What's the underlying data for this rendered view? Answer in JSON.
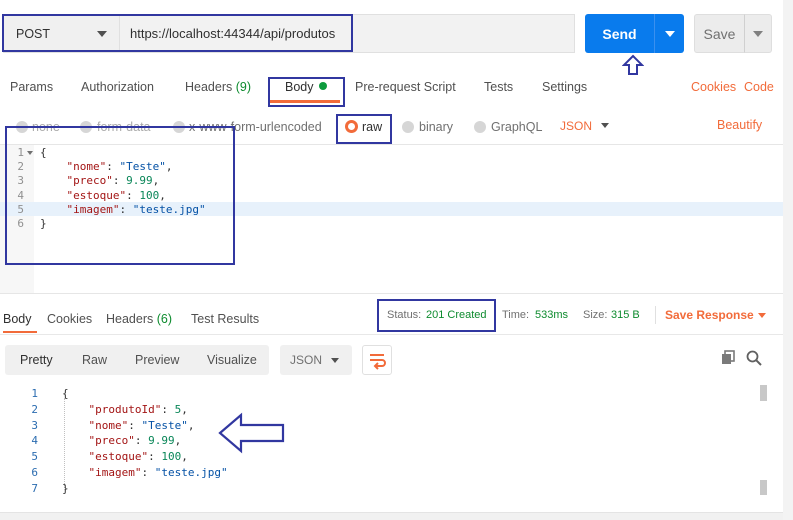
{
  "request": {
    "method": "POST",
    "url": "https://localhost:44344/api/produtos",
    "send_label": "Send",
    "save_label": "Save"
  },
  "request_tabs": {
    "params": "Params",
    "authorization": "Authorization",
    "headers": "Headers",
    "headers_count": "(9)",
    "body": "Body",
    "prerequest": "Pre-request Script",
    "tests": "Tests",
    "settings": "Settings",
    "cookies": "Cookies",
    "code": "Code"
  },
  "body_types": {
    "none": "none",
    "form_data": "form-data",
    "urlencoded": "x-www-form-urlencoded",
    "raw": "raw",
    "binary": "binary",
    "graphql": "GraphQL",
    "format": "JSON",
    "beautify": "Beautify"
  },
  "request_editor": {
    "line_numbers": [
      "1",
      "2",
      "3",
      "4",
      "5",
      "6"
    ],
    "lines": [
      {
        "pre": "{",
        "key": "",
        "mid": "",
        "val": "",
        "post": ""
      },
      {
        "pre": "    ",
        "key": "\"nome\"",
        "mid": ": ",
        "val": "\"Teste\"",
        "post": ","
      },
      {
        "pre": "    ",
        "key": "\"preco\"",
        "mid": ": ",
        "val": "9.99",
        "post": ","
      },
      {
        "pre": "    ",
        "key": "\"estoque\"",
        "mid": ": ",
        "val": "100",
        "post": ","
      },
      {
        "pre": "    ",
        "key": "\"imagem\"",
        "mid": ": ",
        "val": "\"teste.jpg\"",
        "post": ""
      },
      {
        "pre": "}",
        "key": "",
        "mid": "",
        "val": "",
        "post": ""
      }
    ]
  },
  "response_tabs": {
    "body": "Body",
    "cookies": "Cookies",
    "headers": "Headers",
    "headers_count": "(6)",
    "test_results": "Test Results"
  },
  "response_meta": {
    "status_label": "Status:",
    "status_value": "201 Created",
    "time_label": "Time:",
    "time_value": "533ms",
    "size_label": "Size:",
    "size_value": "315 B",
    "save_response": "Save Response"
  },
  "response_toolbar": {
    "pretty": "Pretty",
    "raw": "Raw",
    "preview": "Preview",
    "visualize": "Visualize",
    "format": "JSON"
  },
  "response_body": {
    "line_numbers": [
      "1",
      "2",
      "3",
      "4",
      "5",
      "6",
      "7"
    ],
    "lines": [
      {
        "pre": "{",
        "key": "",
        "mid": "",
        "val": "",
        "post": ""
      },
      {
        "pre": "    ",
        "key": "\"produtoId\"",
        "mid": ": ",
        "val": "5",
        "post": ","
      },
      {
        "pre": "    ",
        "key": "\"nome\"",
        "mid": ": ",
        "val": "\"Teste\"",
        "post": ","
      },
      {
        "pre": "    ",
        "key": "\"preco\"",
        "mid": ": ",
        "val": "9.99",
        "post": ","
      },
      {
        "pre": "    ",
        "key": "\"estoque\"",
        "mid": ": ",
        "val": "100",
        "post": ","
      },
      {
        "pre": "    ",
        "key": "\"imagem\"",
        "mid": ": ",
        "val": "\"teste.jpg\"",
        "post": ""
      },
      {
        "pre": "}",
        "key": "",
        "mid": "",
        "val": "",
        "post": ""
      }
    ]
  },
  "colors": {
    "accent": "#f26b3a",
    "send_blue": "#097bed",
    "status_green": "#0d8b2e",
    "annotation": "#3137a0"
  }
}
